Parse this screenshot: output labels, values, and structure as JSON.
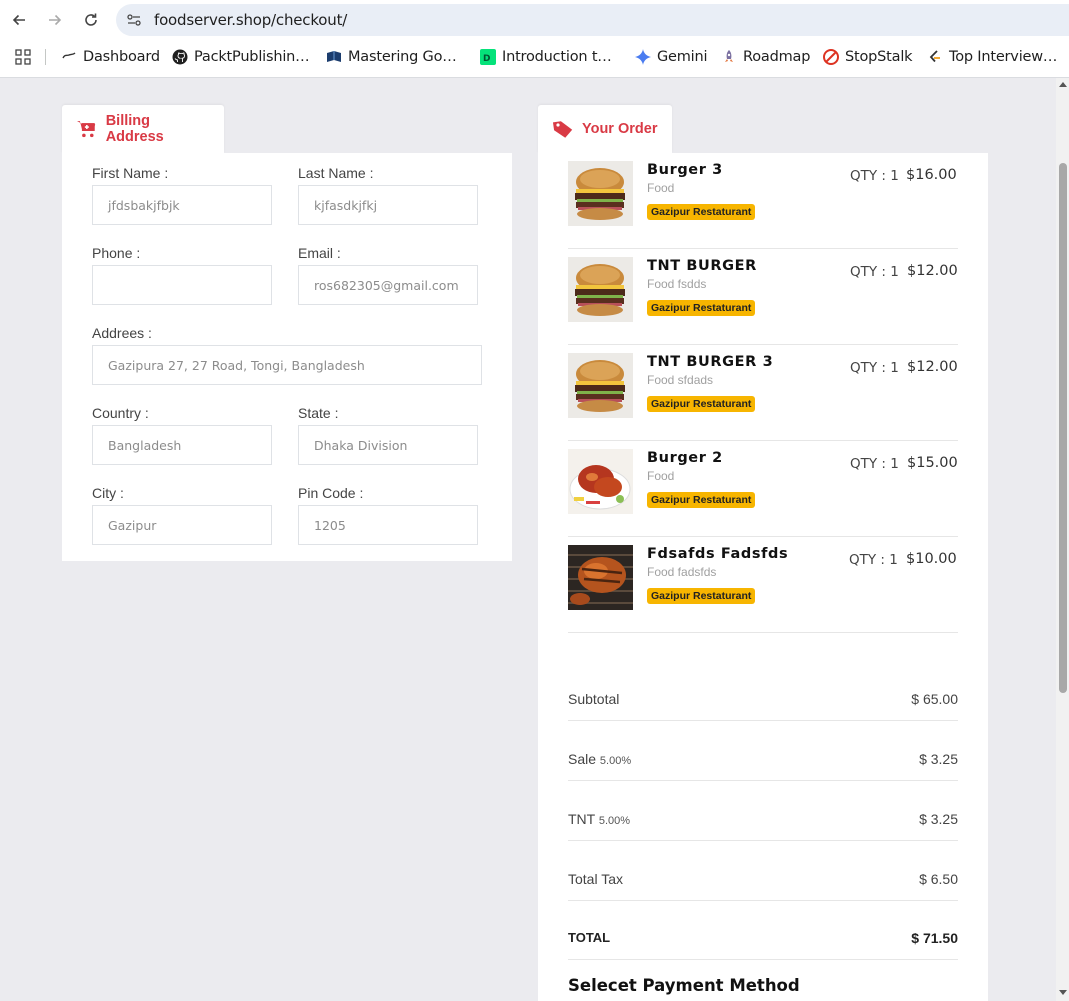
{
  "browser": {
    "url": "foodserver.shop/checkout/",
    "bookmarks": [
      {
        "label": "Dashboard",
        "icon": "dashboard-icon"
      },
      {
        "label": "PacktPublishin…",
        "icon": "github-icon"
      },
      {
        "label": "Mastering Go…",
        "icon": "book-icon"
      },
      {
        "label": "Introduction t…",
        "icon": "dc-icon"
      },
      {
        "label": "Gemini",
        "icon": "gemini-icon"
      },
      {
        "label": "Roadmap",
        "icon": "rocket-icon"
      },
      {
        "label": "StopStalk",
        "icon": "stopstalk-icon"
      },
      {
        "label": "Top Interview…",
        "icon": "leetcode-icon"
      }
    ]
  },
  "billing": {
    "tab_label": "Billing Address",
    "fields": {
      "first_name": {
        "label": "First Name :",
        "value": "jfdsbakjfbjk"
      },
      "last_name": {
        "label": "Last Name :",
        "value": "kjfasdkjfkj"
      },
      "phone": {
        "label": "Phone :",
        "value": ""
      },
      "email": {
        "label": "Email :",
        "value": "ros682305@gmail.com"
      },
      "address": {
        "label": "Addrees :",
        "value": "Gazipura 27, 27 Road, Tongi, Bangladesh"
      },
      "country": {
        "label": "Country :",
        "value": "Bangladesh"
      },
      "state": {
        "label": "State :",
        "value": "Dhaka Division"
      },
      "city": {
        "label": "City :",
        "value": "Gazipur"
      },
      "pin": {
        "label": "Pin Code :",
        "value": "1205"
      }
    }
  },
  "order": {
    "tab_label": "Your Order",
    "items": [
      {
        "name": "Burger 3",
        "category": "Food",
        "restaurant": "Gazipur Restaturant",
        "qty": "QTY : 1",
        "price": "$16.00",
        "image": "burger"
      },
      {
        "name": "TNT BURGER",
        "category": "Food fsdds",
        "restaurant": "Gazipur Restaturant",
        "qty": "QTY : 1",
        "price": "$12.00",
        "image": "burger"
      },
      {
        "name": "TNT BURGER 3",
        "category": "Food sfdads",
        "restaurant": "Gazipur Restaturant",
        "qty": "QTY : 1",
        "price": "$12.00",
        "image": "burger"
      },
      {
        "name": "Burger 2",
        "category": "Food",
        "restaurant": "Gazipur Restaturant",
        "qty": "QTY : 1",
        "price": "$15.00",
        "image": "chicken"
      },
      {
        "name": "Fdsafds Fadsfds",
        "category": "Food fadsfds",
        "restaurant": "Gazipur Restaturant",
        "qty": "QTY : 1",
        "price": "$10.00",
        "image": "grill"
      }
    ],
    "summary": {
      "subtotal_label": "Subtotal",
      "subtotal": "$ 65.00",
      "sale_label": "Sale",
      "sale_rate": "5.00%",
      "sale": "$ 3.25",
      "tnt_label": "TNT",
      "tnt_rate": "5.00%",
      "tnt": "$ 3.25",
      "total_tax_label": "Total Tax",
      "total_tax": "$ 6.50",
      "total_label": "TOTAL",
      "total": "$ 71.50"
    },
    "payment_title": "Selecet Payment Method"
  },
  "colors": {
    "accent": "#d93a45",
    "badge": "#f7b500",
    "background": "#ebebef"
  }
}
